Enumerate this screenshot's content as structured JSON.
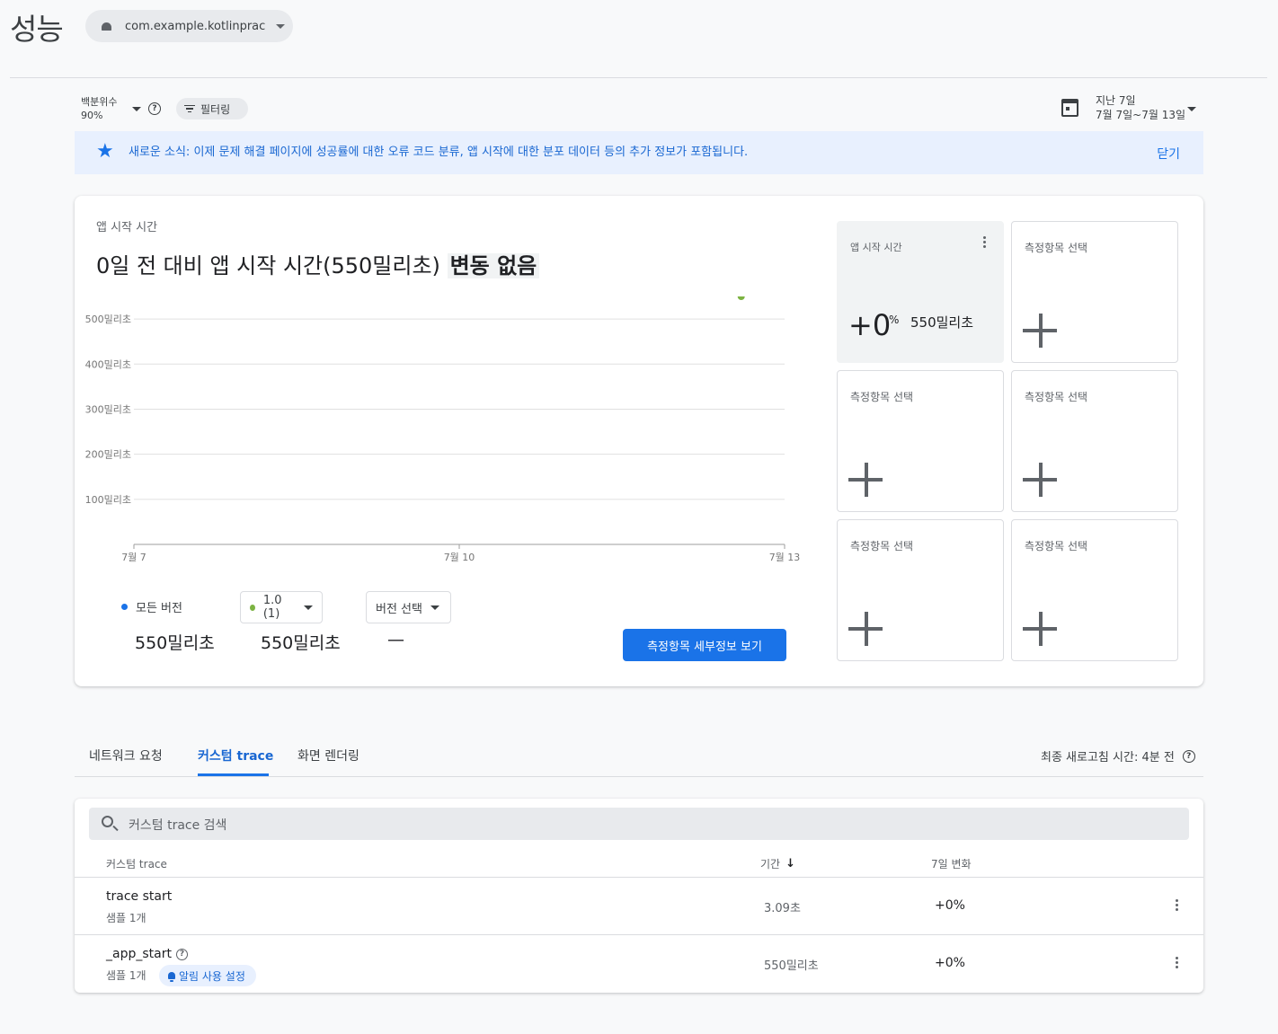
{
  "header": {
    "title": "성능",
    "app_selector": "com.example.kotlinprac"
  },
  "toolbar": {
    "percentile_label": "백분위수",
    "percentile_value": "90%",
    "filter_label": "필터링",
    "date_range_label": "지난 7일",
    "date_range_value": "7월 7일~7월 13일"
  },
  "banner": {
    "message": "새로운 소식: 이제 문제 해결 페이지에 성공률에 대한 오류 코드 분류, 앱 시작에 대한 분포 데이터 등의 추가 정보가 포함됩니다.",
    "close_label": "닫기"
  },
  "metric_card": {
    "subtitle": "앱 시작 시간",
    "headline_prefix": "0일 전 대비 앱 시작 시간(550밀리초)",
    "headline_highlight": "변동 없음",
    "legend_all_versions": "모든 버전",
    "version_selected": "1.0 (1)",
    "version_select_placeholder": "버전 선택",
    "value_all_versions": "550밀리초",
    "value_version": "550밀리초",
    "value_empty": "—",
    "detail_button": "측정항목 세부정보 보기",
    "colors": {
      "all_versions": "#1a73e8",
      "version": "#7cb342"
    }
  },
  "chart_data": {
    "type": "scatter",
    "title": "",
    "xlabel": "",
    "ylabel": "",
    "x_ticks": [
      "7월 7",
      "7월 10",
      "7월 13"
    ],
    "y_ticks": [
      "100밀리초",
      "200밀리초",
      "300밀리초",
      "400밀리초",
      "500밀리초"
    ],
    "y_tick_values": [
      100,
      200,
      300,
      400,
      500
    ],
    "ylim": [
      0,
      550
    ],
    "xlim": [
      7,
      13
    ],
    "grid": true,
    "series": [
      {
        "name": "1.0 (1)",
        "color": "#7cb342",
        "points": [
          {
            "x": 12.6,
            "y": 550
          }
        ]
      }
    ]
  },
  "tiles": [
    {
      "label": "앱 시작 시간",
      "active": true,
      "change": "+0",
      "change_unit": "%",
      "value": "550밀리초"
    },
    {
      "label": "측정항목 선택"
    },
    {
      "label": "측정항목 선택"
    },
    {
      "label": "측정항목 선택"
    },
    {
      "label": "측정항목 선택"
    },
    {
      "label": "측정항목 선택"
    }
  ],
  "tabs": {
    "items": [
      "네트워크 요청",
      "커스텀 trace",
      "화면 렌더링"
    ],
    "active": "커스텀 trace",
    "refresh_text": "최종 새로고침 시간: 4분 전"
  },
  "trace_table": {
    "search_placeholder": "커스텀 trace 검색",
    "columns": [
      "커스텀 trace",
      "기간",
      "7일 변화"
    ],
    "rows": [
      {
        "name": "trace start",
        "samples": "샘플 1개",
        "duration": "3.09초",
        "change": "+0%"
      },
      {
        "name": "_app_start",
        "samples": "샘플 1개",
        "duration": "550밀리초",
        "change": "+0%",
        "alert": "알림 사용 설정"
      }
    ]
  }
}
